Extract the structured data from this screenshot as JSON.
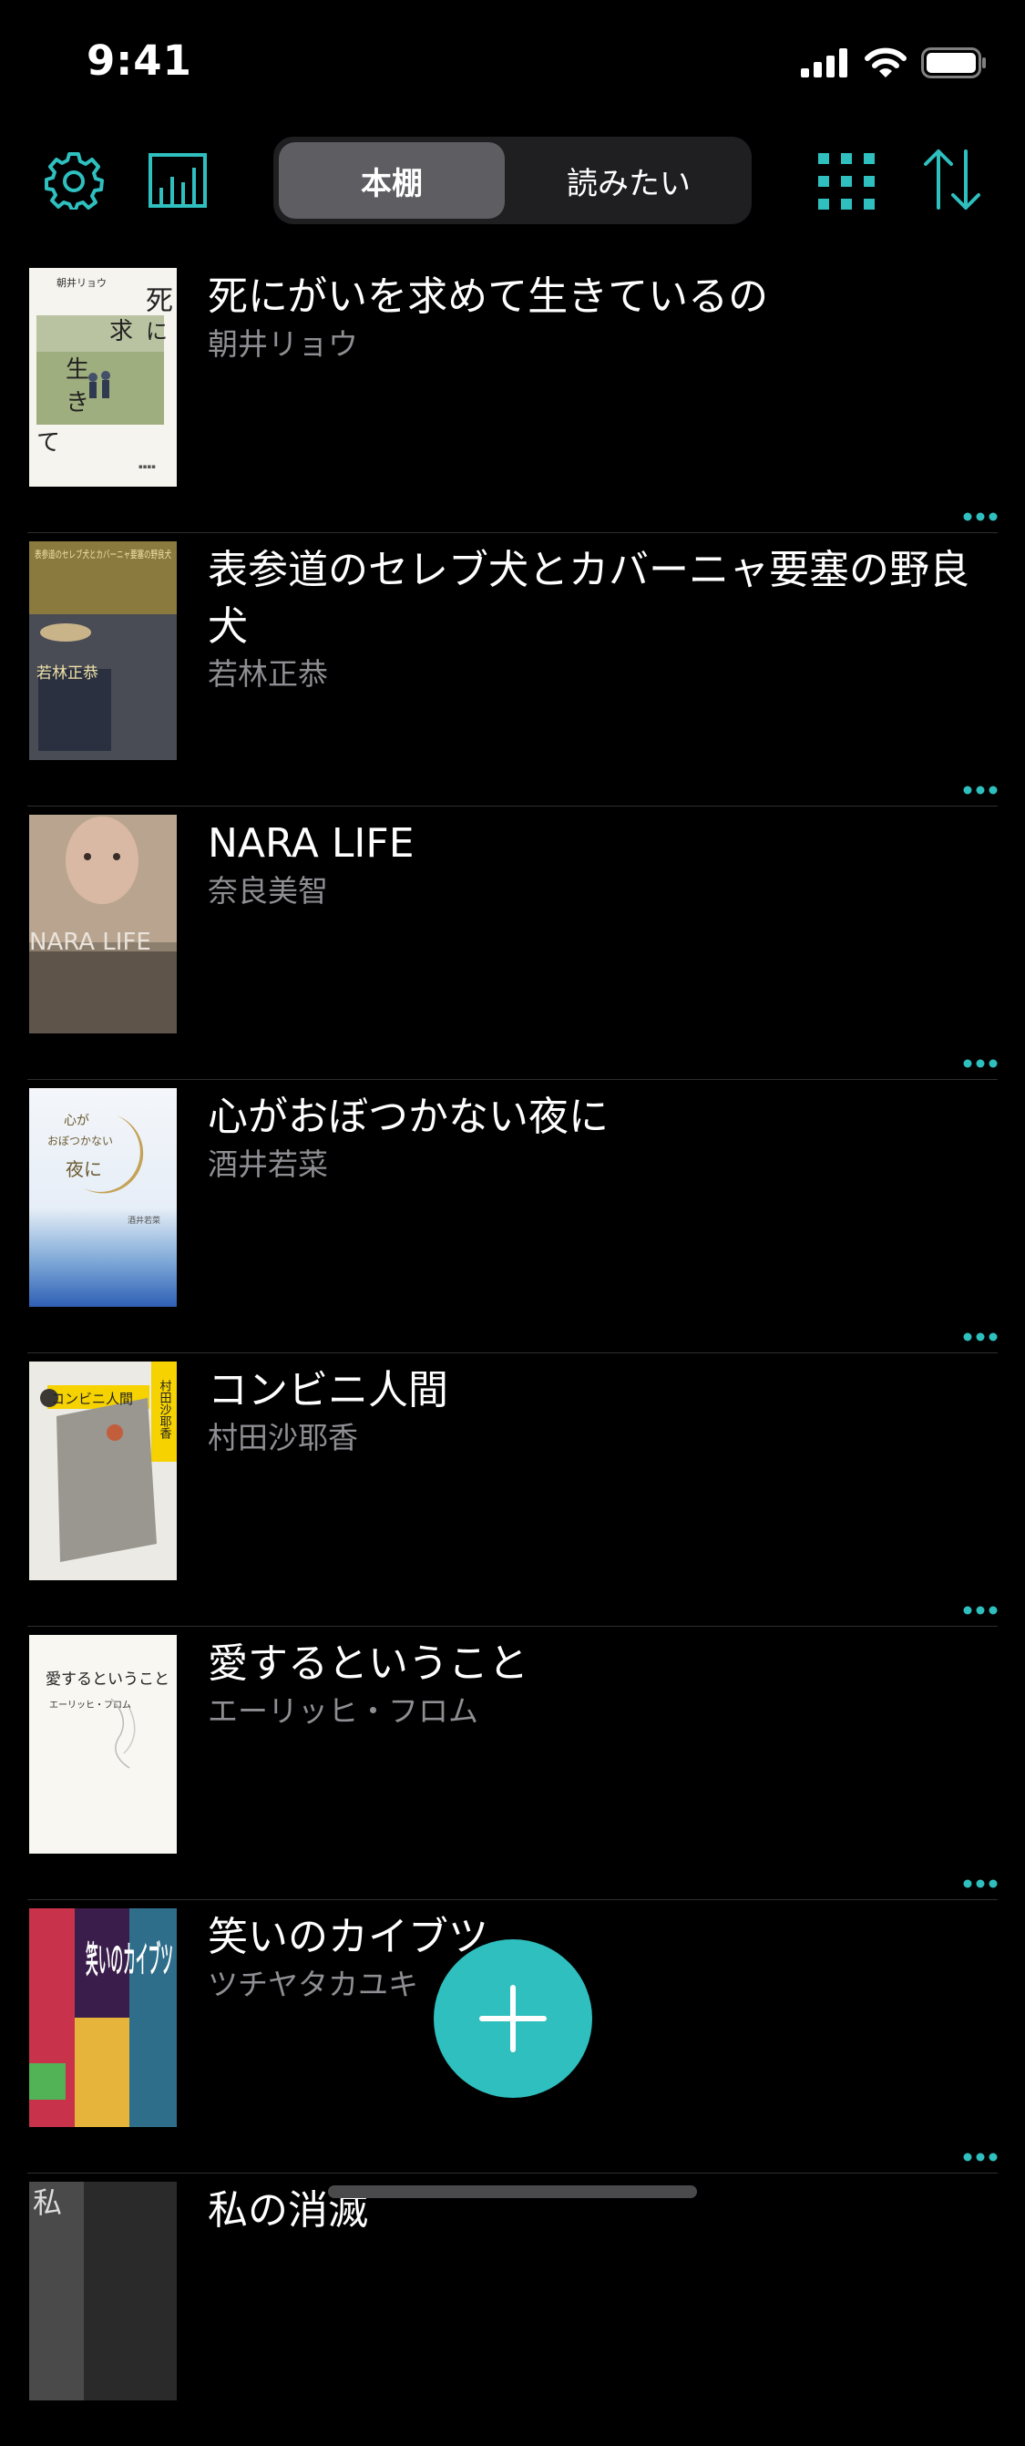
{
  "status_bar": {
    "time": "9:41"
  },
  "toolbar": {
    "settings_icon": "gear-icon",
    "stats_icon": "bar-chart-icon",
    "grid_icon": "grid-icon",
    "sort_icon": "sort-arrows-icon",
    "tabs": [
      {
        "label": "本棚",
        "active": true
      },
      {
        "label": "読みたい",
        "active": false
      }
    ]
  },
  "colors": {
    "accent": "#2fbfbf",
    "background": "#000000",
    "secondary_text": "#8e8e93"
  },
  "books": [
    {
      "title": "死にがいを求めて生きているの",
      "author": "朝井リョウ"
    },
    {
      "title": "表参道のセレブ犬とカバーニャ要塞の野良犬",
      "author": "若林正恭"
    },
    {
      "title": "NARA LIFE",
      "author": "奈良美智"
    },
    {
      "title": "心がおぼつかない夜に",
      "author": "酒井若菜"
    },
    {
      "title": "コンビニ人間",
      "author": "村田沙耶香"
    },
    {
      "title": "愛するということ",
      "author": "エーリッヒ・フロム"
    },
    {
      "title": "笑いのカイブツ",
      "author": "ツチヤタカユキ"
    },
    {
      "title": "私の消滅",
      "author": ""
    }
  ],
  "cover_texts": {
    "book0_author": "朝井リョウ",
    "book0_title": "死にがいを求めて生きているの",
    "book1_top": "表参道のセレブ犬とカバーニャ要塞の野良犬",
    "book1_author": "若林正恭",
    "book2_title": "NARA LIFE",
    "book3_title1": "心が",
    "book3_title2": "おぼつかない",
    "book3_title3": "夜に",
    "book3_author": "酒井若菜",
    "book4_title": "コンビニ人間",
    "book4_author": "村田沙耶香",
    "book5_title": "愛するということ",
    "book5_author": "エーリッヒ・フロム",
    "book6_title": "笑いのカイブツ",
    "book7_title": "私"
  },
  "fab": {
    "icon": "plus-icon"
  }
}
